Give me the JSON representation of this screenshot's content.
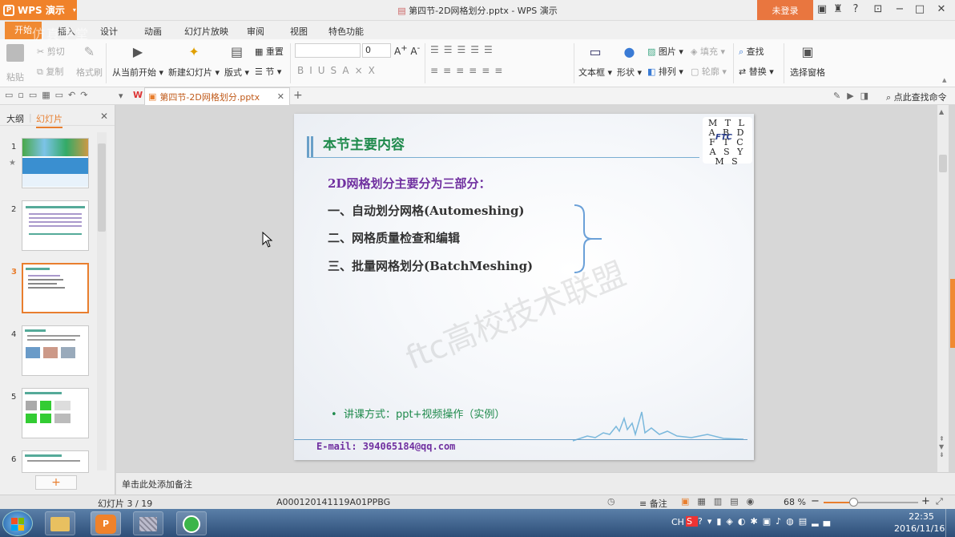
{
  "titlebar": {
    "app_label": "WPS 演示",
    "document_title": "第四节-2D网格划分.pptx - WPS 演示",
    "login_label": "未登录"
  },
  "ribbon_tabs": [
    "开始",
    "插入",
    "设计",
    "动画",
    "幻灯片放映",
    "审阅",
    "视图",
    "特色功能"
  ],
  "top_watermark": "仿真学堂",
  "ribbon": {
    "paste": "粘贴",
    "cut": "剪切",
    "copy": "复制",
    "format_painter": "格式刷",
    "from_current": "从当前开始",
    "new_slide": "新建幻灯片",
    "layout": "版式",
    "reset": "重置",
    "section": "节",
    "font_size": "0",
    "textbox": "文本框",
    "shape": "形状",
    "picture": "图片",
    "fill": "填充",
    "arrange": "排列",
    "outline": "轮廓",
    "find": "查找",
    "replace": "替换",
    "select_pane": "选择窗格"
  },
  "quickbar": {
    "tab_label": "第四节-2D网格划分.pptx",
    "search_label": "点此查找命令"
  },
  "leftpanel": {
    "tab_outline": "大纲",
    "tab_slides": "幻灯片",
    "slide_numbers": [
      "1",
      "2",
      "3",
      "4",
      "5",
      "6"
    ],
    "add_label": "+"
  },
  "slide": {
    "title": "本节主要内容",
    "heading": "2D网格划分主要分为三部分：",
    "items": [
      "一、自动划分网格(Automeshing)",
      "二、网格质量检查和编辑",
      "三、批量网格划分(BatchMeshing)"
    ],
    "bullet": "讲课方式：ppt+视频操作（实例）",
    "email": "E-mail: 394065184@qq.com",
    "watermark": "ftc高校技术联盟",
    "logo_letters": "M T L A B D F T C A S Y M S",
    "logo_mid": "FTC"
  },
  "notes_placeholder": "单击此处添加备注",
  "statusbar": {
    "slide_counter": "幻灯片 3 / 19",
    "doc_code": "A000120141119A01PPBG",
    "notes_btn": "备注",
    "zoom": "68 %"
  },
  "taskbar": {
    "lang": "CH",
    "time": "22:35",
    "date": "2016/11/16"
  },
  "colors": {
    "accent_orange": "#f0822a",
    "slide_title_green": "#1f8a4c",
    "heading_purple": "#7030a0"
  }
}
